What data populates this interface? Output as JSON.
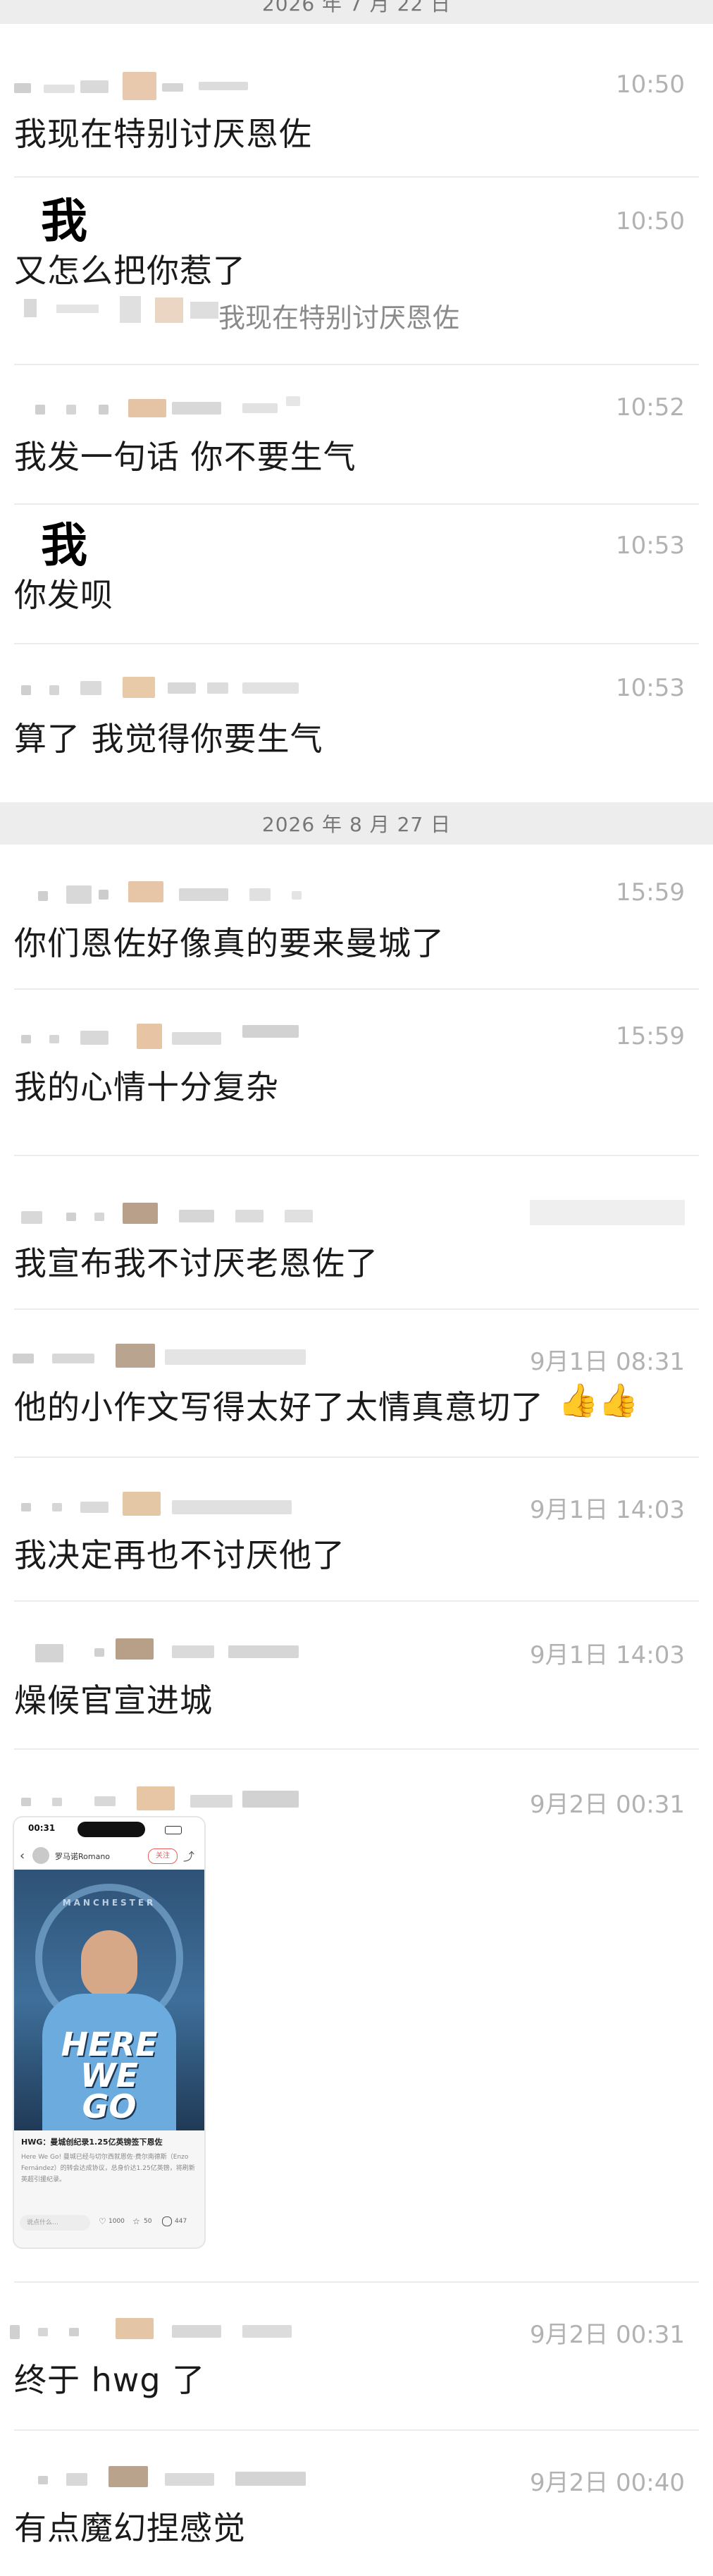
{
  "date_separators": [
    "2026 年 7 月 22 日",
    "2026 年 8 月 27 日"
  ],
  "messages": [
    {
      "time": "10:50",
      "text": "我现在特别讨厌恩佐"
    },
    {
      "sender_name": "我",
      "time": "10:50",
      "text": "又怎么把你惹了",
      "quote": "我现在特别讨厌恩佐"
    },
    {
      "time": "10:52",
      "text": "我发一句话 你不要生气"
    },
    {
      "sender_name": "我",
      "time": "10:53",
      "text": "你发呗"
    },
    {
      "time": "10:53",
      "text": "算了 我觉得你要生气"
    },
    {
      "time": "15:59",
      "text": "你们恩佐好像真的要来曼城了"
    },
    {
      "time": "15:59",
      "text": "我的心情十分复杂"
    },
    {
      "time": "",
      "text": "我宣布我不讨厌老恩佐了"
    },
    {
      "time": "9月1日 08:31",
      "text": "他的小作文写得太好了太情真意切了"
    },
    {
      "time": "9月1日 14:03",
      "text": "我决定再也不讨厌他了"
    },
    {
      "time": "9月1日 14:03",
      "text": "燥候官宣进城"
    },
    {
      "time": "9月2日 00:31",
      "text": ""
    },
    {
      "time": "9月2日 00:31",
      "text": "终于 hwg 了"
    },
    {
      "time": "9月2日 00:40",
      "text": "有点魔幻捏感觉"
    }
  ],
  "image_post": {
    "status_time": "00:31",
    "author": "罗马诺Romano",
    "follow_label": "关注",
    "poster_lines": [
      "HERE",
      "WE",
      "GO"
    ],
    "poster_badge": "MANCHESTER",
    "post_title": "HWG：曼城创纪录1.25亿英镑签下恩佐",
    "post_body": "Here We Go! 曼城已经与切尔西就恩佐·费尔南德斯（Enzo Fernández）的转会达成协议，总身价达1.25亿英镑，将刷新英超引援纪录。",
    "comment_placeholder": "说点什么…",
    "likes": "1000",
    "favorites": "50",
    "comments": "447"
  },
  "emoji": [
    "👍",
    "👍"
  ],
  "colors": {
    "background": "#ffffff",
    "date_band": "#ededed",
    "time_text": "#b2b2b2",
    "divider": "#ececec",
    "jersey_blue": "#6cabdd"
  }
}
